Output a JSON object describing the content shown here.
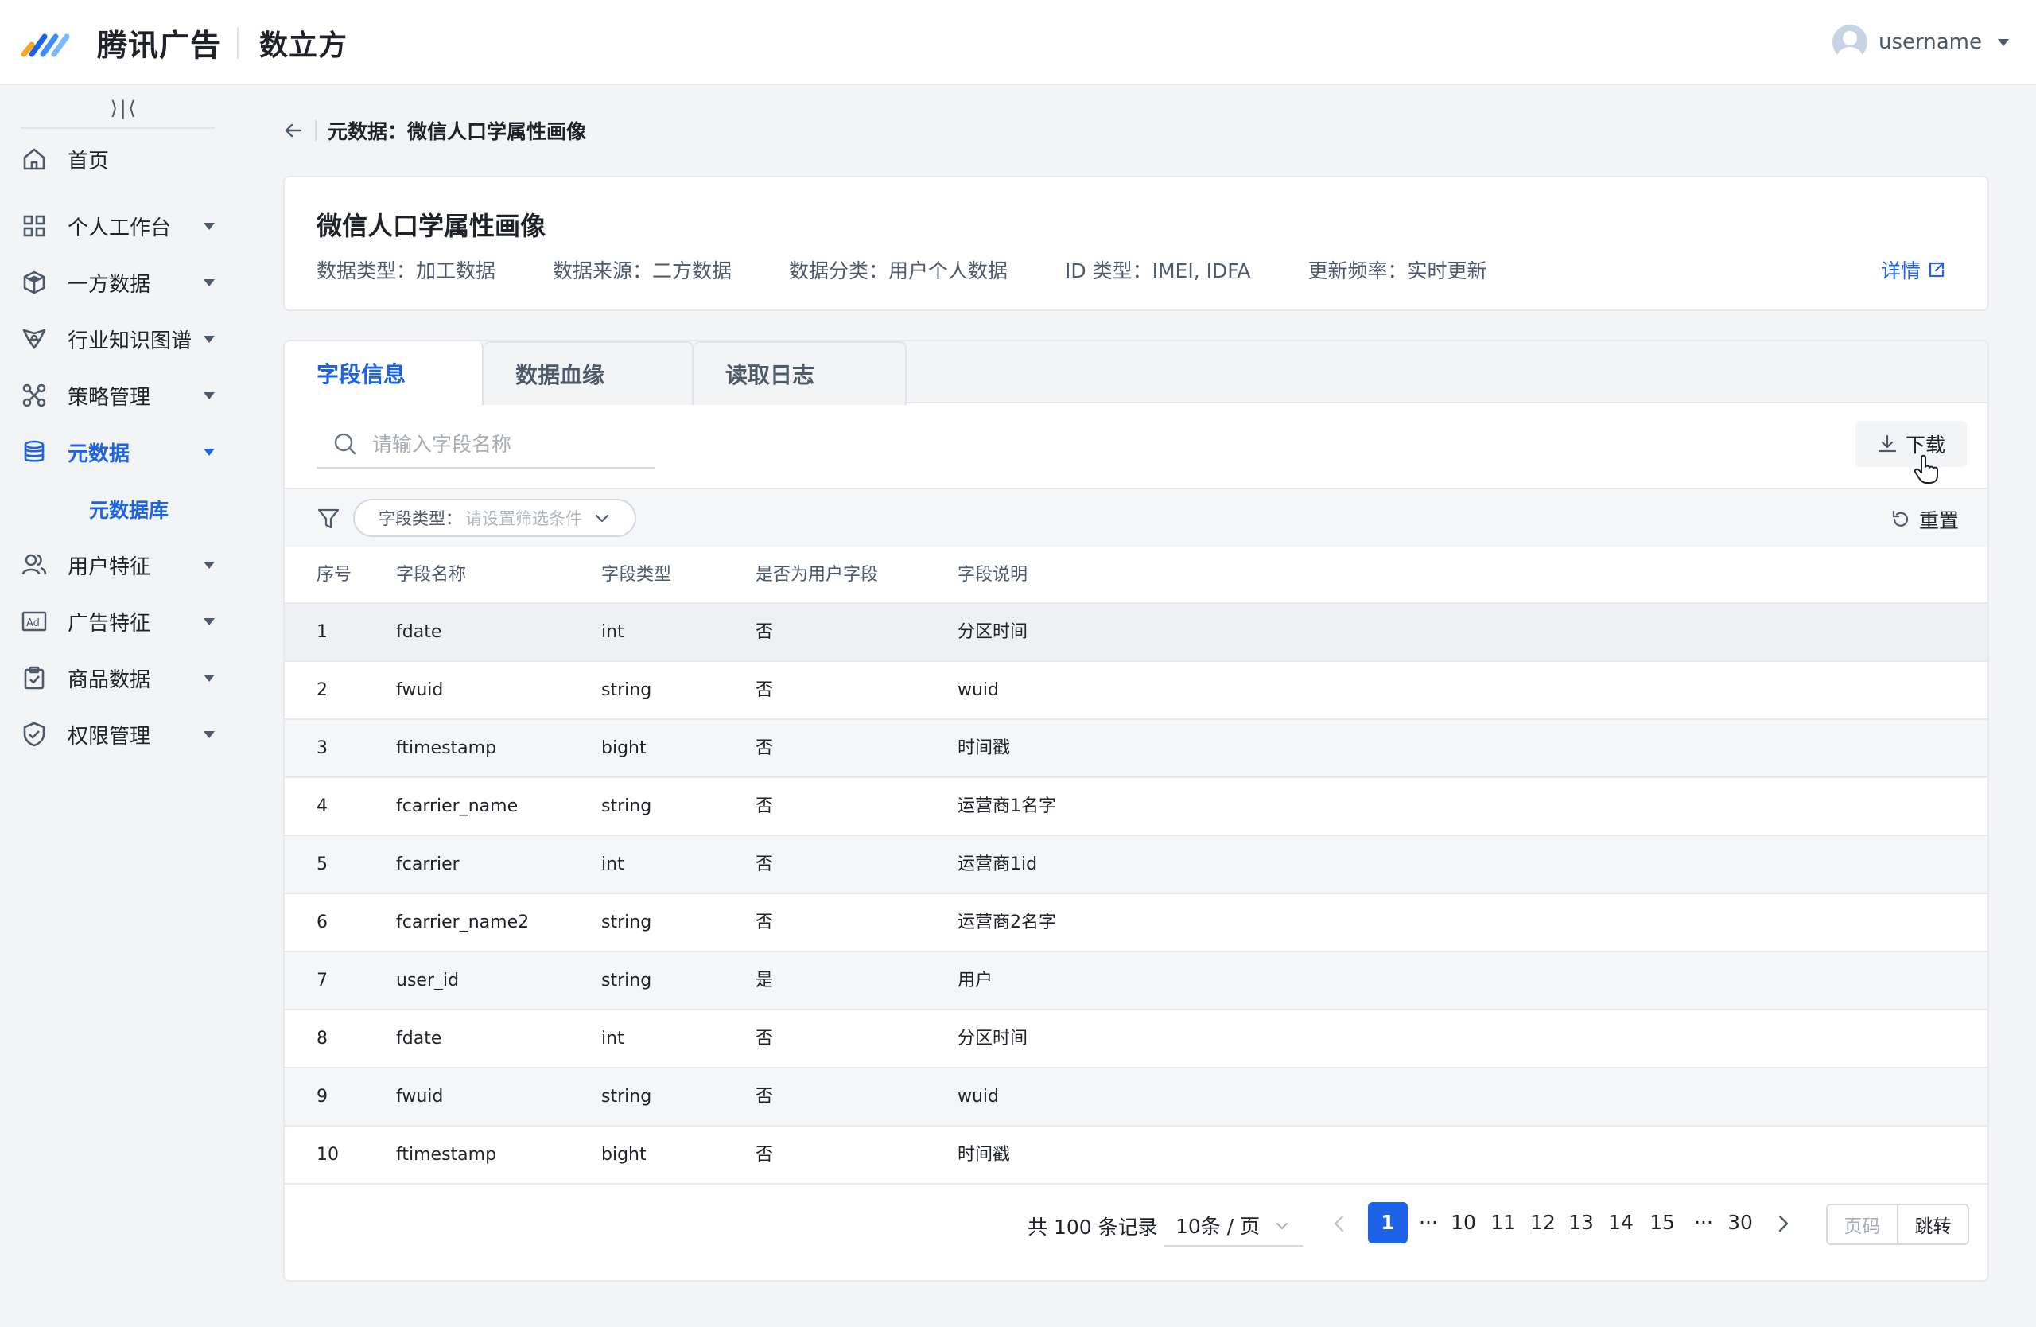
{
  "header": {
    "brand": "腾讯广告",
    "product": "数立方",
    "username": "username"
  },
  "sidebar": {
    "collapse_icon": "collapse-icon",
    "items": [
      {
        "label": "首页",
        "icon": "home-icon",
        "has_arrow": false
      },
      {
        "label": "个人工作台",
        "icon": "grid-icon",
        "has_arrow": true
      },
      {
        "label": "一方数据",
        "icon": "cube-icon",
        "has_arrow": true
      },
      {
        "label": "行业知识图谱",
        "icon": "graph-icon",
        "has_arrow": true
      },
      {
        "label": "策略管理",
        "icon": "strategy-icon",
        "has_arrow": true
      },
      {
        "label": "元数据",
        "icon": "database-icon",
        "has_arrow": true,
        "active": true
      },
      {
        "label": "用户特征",
        "icon": "users-icon",
        "has_arrow": true
      },
      {
        "label": "广告特征",
        "icon": "ad-icon",
        "has_arrow": true
      },
      {
        "label": "商品数据",
        "icon": "clipboard-icon",
        "has_arrow": true
      },
      {
        "label": "权限管理",
        "icon": "shield-icon",
        "has_arrow": true
      }
    ],
    "sub_item": "元数据库"
  },
  "breadcrumb": {
    "text": "元数据：微信人口学属性画像"
  },
  "info": {
    "title": "微信人口学属性画像",
    "meta": [
      "数据类型：加工数据",
      "数据来源：二方数据",
      "数据分类：用户个人数据",
      "ID 类型：IMEI, IDFA",
      "更新频率：实时更新"
    ],
    "detail_link": "详情"
  },
  "tabs": [
    "字段信息",
    "数据血缘",
    "读取日志"
  ],
  "search": {
    "placeholder": "请输入字段名称",
    "value": ""
  },
  "download_label": "下载",
  "filter": {
    "key": "字段类型：",
    "placeholder": "请设置筛选条件"
  },
  "reset_label": "重置",
  "table": {
    "columns": [
      "序号",
      "字段名称",
      "字段类型",
      "是否为用户字段",
      "字段说明"
    ],
    "rows": [
      [
        "1",
        "fdate",
        "int",
        "否",
        "分区时间"
      ],
      [
        "2",
        "fwuid",
        "string",
        "否",
        "wuid"
      ],
      [
        "3",
        "ftimestamp",
        "bight",
        "否",
        "时间戳"
      ],
      [
        "4",
        "fcarrier_name",
        "string",
        "否",
        "运营商1名字"
      ],
      [
        "5",
        "fcarrier",
        "int",
        "否",
        "运营商1id"
      ],
      [
        "6",
        "fcarrier_name2",
        "string",
        "否",
        "运营商2名字"
      ],
      [
        "7",
        "user_id",
        "string",
        "是",
        "用户"
      ],
      [
        "8",
        "fdate",
        "int",
        "否",
        "分区时间"
      ],
      [
        "9",
        "fwuid",
        "string",
        "否",
        "wuid"
      ],
      [
        "10",
        "ftimestamp",
        "bight",
        "否",
        "时间戳"
      ]
    ]
  },
  "pagination": {
    "total_text": "共 100 条记录",
    "page_size": "10条 / 页",
    "current": "1",
    "ellipsis": "···",
    "pages": [
      "10",
      "11",
      "12",
      "13",
      "14",
      "15"
    ],
    "last": "30",
    "jump_placeholder": "页码",
    "jump_label": "跳转"
  },
  "colors": {
    "accent": "#1d63e8",
    "background": "#f3f4f6",
    "card": "#ffffff"
  }
}
